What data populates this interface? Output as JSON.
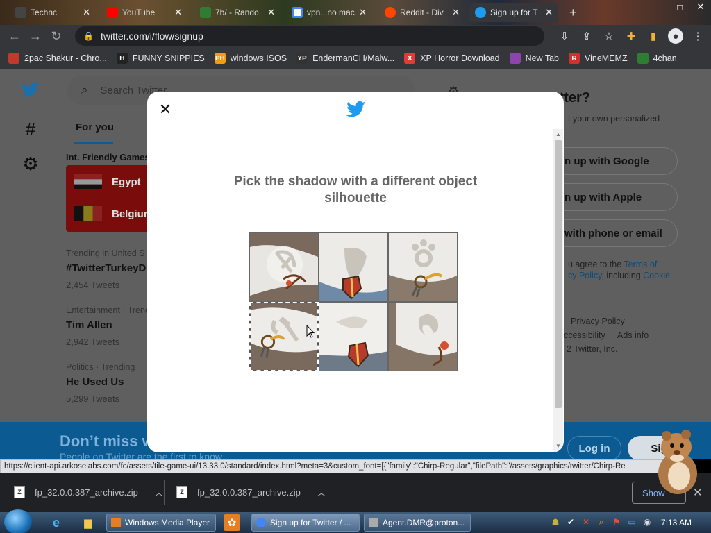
{
  "browser": {
    "tabs": [
      {
        "label": "Technc",
        "icon": "grid-icon"
      },
      {
        "label": "YouTube",
        "icon": "youtube-icon"
      },
      {
        "label": "7b/ - Rando",
        "icon": "4chan-icon"
      },
      {
        "label": "vpn...no mac",
        "icon": "google-icon"
      },
      {
        "label": "Reddit - Div",
        "icon": "reddit-icon"
      },
      {
        "label": "Sign up for T",
        "icon": "twitter-icon"
      }
    ],
    "new_tab": "+",
    "url": "twitter.com/i/flow/signup",
    "bookmarks": [
      {
        "label": "2pac Shakur - Chro...",
        "icon_text": "",
        "color": "#c0392b"
      },
      {
        "label": "FUNNY SNIPPIES",
        "icon_text": "H",
        "color": "#222222"
      },
      {
        "label": "windows ISOS",
        "icon_text": "PH",
        "color": "#f39c12"
      },
      {
        "label": "EndermanCH/Malw...",
        "icon_text": "YP",
        "color": "#333333"
      },
      {
        "label": "XP Horror Download",
        "icon_text": "X",
        "color": "#e53935"
      },
      {
        "label": "New Tab",
        "icon_text": "",
        "color": "#8e44ad"
      },
      {
        "label": "VineMEMZ",
        "icon_text": "R",
        "color": "#d32f2f"
      },
      {
        "label": "4chan",
        "icon_text": "",
        "color": "#2e7d32"
      }
    ]
  },
  "twitter": {
    "search_placeholder": "Search Twitter",
    "tab_for_you": "For you",
    "section_title": "Int. Friendly Games",
    "teams": [
      "Egypt",
      "Belgium"
    ],
    "trends": [
      {
        "meta": "Trending in United S",
        "title": "#TwitterTurkeyD",
        "count": "2,454 Tweets"
      },
      {
        "meta": "Entertainment · Trend",
        "title": "Tim Allen",
        "count": "2,942 Tweets"
      },
      {
        "meta": "Politics · Trending",
        "title": "He Used Us",
        "count": "5,299 Tweets"
      }
    ],
    "right": {
      "heading": "itter?",
      "subtext": "t your own personalized",
      "btn_google": "n up with Google",
      "btn_apple": "n up with Apple",
      "btn_phone": "with phone or email",
      "agree_1": "u agree to the",
      "terms": "Terms of",
      "agree_2": "cy Policy",
      "agree_3": ", including",
      "cookie": "Cookie",
      "privacy": "Privacy Policy",
      "accessibility": "ccessibility",
      "ads": "Ads info",
      "copyright": "2 Twitter, Inc."
    },
    "banner_big": "Don’t miss w",
    "banner_small": "People on Twitter are the first to know.",
    "login": "Log in",
    "signup": "Sig"
  },
  "modal": {
    "prompt": "Pick the shadow with a different object silhouette",
    "tiles": [
      {
        "name": "tile-1",
        "shadow": "hammer-bow",
        "object": "bow-and-arrow"
      },
      {
        "name": "tile-2",
        "shadow": "leaf",
        "object": "shield"
      },
      {
        "name": "tile-3",
        "shadow": "ring-frog",
        "object": "keys"
      },
      {
        "name": "tile-4",
        "shadow": "hammer-axe",
        "object": "keys"
      },
      {
        "name": "tile-5",
        "shadow": "fish",
        "object": "shield"
      },
      {
        "name": "tile-6",
        "shadow": "hair",
        "object": "bow"
      }
    ],
    "selected_tile": 4
  },
  "status_url": "https://client-api.arkoselabs.com/fc/assets/tile-game-ui/13.33.0/standard/index.html?meta=3&custom_font=[{\"family\":\"Chirp-Regular\",\"filePath\":\"/assets/graphics/twitter/Chirp-Re",
  "downloads": [
    {
      "file": "fp_32.0.0.387_archive.zip"
    },
    {
      "file": "fp_32.0.0.387_archive.zip"
    }
  ],
  "show_all": "Show",
  "taskbar": {
    "tasks": [
      {
        "label": "Windows Media Player",
        "color": "#e67e22"
      },
      {
        "label": "Sign up for Twitter / ...",
        "color": "#4285f4"
      },
      {
        "label": "Agent.DMR@proton...",
        "color": "#888888"
      }
    ],
    "clock": "7:13 AM"
  },
  "colors": {
    "twitter_blue": "#1d9bf0",
    "overlay_blue": "#0c5a92",
    "chrome_dark": "#35363a"
  }
}
